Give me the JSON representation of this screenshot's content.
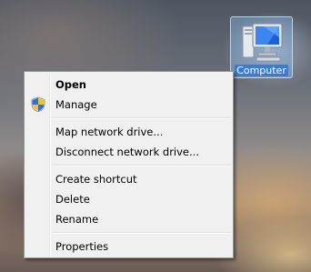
{
  "desktop": {
    "icon": {
      "name": "computer-icon",
      "label": "Computer"
    }
  },
  "context_menu": {
    "items": [
      {
        "label": "Open",
        "bold": true
      },
      {
        "label": "Manage",
        "icon": "uac-shield-icon"
      },
      {
        "label": "Map network drive..."
      },
      {
        "label": "Disconnect network drive..."
      },
      {
        "label": "Create shortcut"
      },
      {
        "label": "Delete"
      },
      {
        "label": "Rename"
      },
      {
        "label": "Properties"
      }
    ]
  },
  "colors": {
    "menu_background": "#f0f0f0",
    "menu_border": "#979797",
    "selection_highlight": "#3a7bd5"
  }
}
